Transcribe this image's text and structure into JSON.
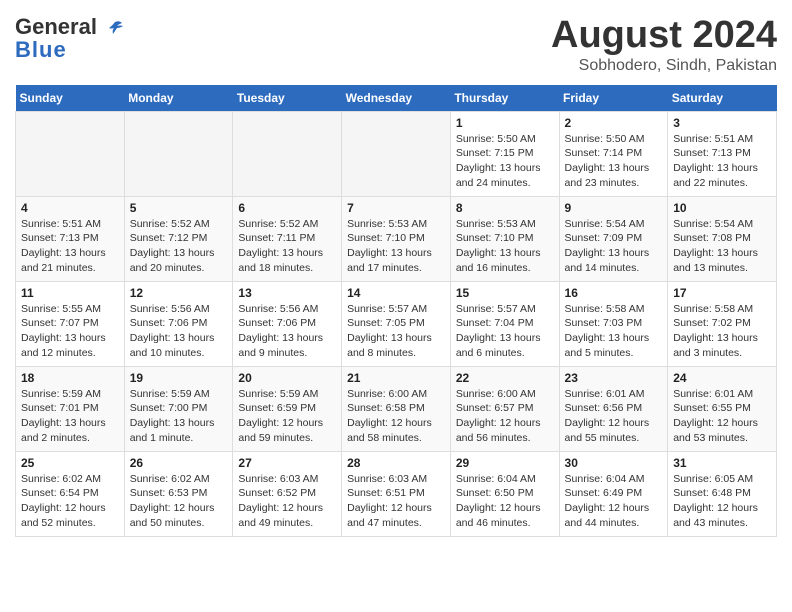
{
  "header": {
    "logo_line1": "General",
    "logo_line2": "Blue",
    "main_title": "August 2024",
    "subtitle": "Sobhodero, Sindh, Pakistan"
  },
  "calendar": {
    "days_of_week": [
      "Sunday",
      "Monday",
      "Tuesday",
      "Wednesday",
      "Thursday",
      "Friday",
      "Saturday"
    ],
    "weeks": [
      [
        {
          "day": "",
          "empty": true
        },
        {
          "day": "",
          "empty": true
        },
        {
          "day": "",
          "empty": true
        },
        {
          "day": "",
          "empty": true
        },
        {
          "day": "1",
          "sunrise": "5:50 AM",
          "sunset": "7:15 PM",
          "daylight": "13 hours and 24 minutes."
        },
        {
          "day": "2",
          "sunrise": "5:50 AM",
          "sunset": "7:14 PM",
          "daylight": "13 hours and 23 minutes."
        },
        {
          "day": "3",
          "sunrise": "5:51 AM",
          "sunset": "7:13 PM",
          "daylight": "13 hours and 22 minutes."
        }
      ],
      [
        {
          "day": "4",
          "sunrise": "5:51 AM",
          "sunset": "7:13 PM",
          "daylight": "13 hours and 21 minutes."
        },
        {
          "day": "5",
          "sunrise": "5:52 AM",
          "sunset": "7:12 PM",
          "daylight": "13 hours and 20 minutes."
        },
        {
          "day": "6",
          "sunrise": "5:52 AM",
          "sunset": "7:11 PM",
          "daylight": "13 hours and 18 minutes."
        },
        {
          "day": "7",
          "sunrise": "5:53 AM",
          "sunset": "7:10 PM",
          "daylight": "13 hours and 17 minutes."
        },
        {
          "day": "8",
          "sunrise": "5:53 AM",
          "sunset": "7:10 PM",
          "daylight": "13 hours and 16 minutes."
        },
        {
          "day": "9",
          "sunrise": "5:54 AM",
          "sunset": "7:09 PM",
          "daylight": "13 hours and 14 minutes."
        },
        {
          "day": "10",
          "sunrise": "5:54 AM",
          "sunset": "7:08 PM",
          "daylight": "13 hours and 13 minutes."
        }
      ],
      [
        {
          "day": "11",
          "sunrise": "5:55 AM",
          "sunset": "7:07 PM",
          "daylight": "13 hours and 12 minutes."
        },
        {
          "day": "12",
          "sunrise": "5:56 AM",
          "sunset": "7:06 PM",
          "daylight": "13 hours and 10 minutes."
        },
        {
          "day": "13",
          "sunrise": "5:56 AM",
          "sunset": "7:06 PM",
          "daylight": "13 hours and 9 minutes."
        },
        {
          "day": "14",
          "sunrise": "5:57 AM",
          "sunset": "7:05 PM",
          "daylight": "13 hours and 8 minutes."
        },
        {
          "day": "15",
          "sunrise": "5:57 AM",
          "sunset": "7:04 PM",
          "daylight": "13 hours and 6 minutes."
        },
        {
          "day": "16",
          "sunrise": "5:58 AM",
          "sunset": "7:03 PM",
          "daylight": "13 hours and 5 minutes."
        },
        {
          "day": "17",
          "sunrise": "5:58 AM",
          "sunset": "7:02 PM",
          "daylight": "13 hours and 3 minutes."
        }
      ],
      [
        {
          "day": "18",
          "sunrise": "5:59 AM",
          "sunset": "7:01 PM",
          "daylight": "13 hours and 2 minutes."
        },
        {
          "day": "19",
          "sunrise": "5:59 AM",
          "sunset": "7:00 PM",
          "daylight": "13 hours and 1 minute."
        },
        {
          "day": "20",
          "sunrise": "5:59 AM",
          "sunset": "6:59 PM",
          "daylight": "12 hours and 59 minutes."
        },
        {
          "day": "21",
          "sunrise": "6:00 AM",
          "sunset": "6:58 PM",
          "daylight": "12 hours and 58 minutes."
        },
        {
          "day": "22",
          "sunrise": "6:00 AM",
          "sunset": "6:57 PM",
          "daylight": "12 hours and 56 minutes."
        },
        {
          "day": "23",
          "sunrise": "6:01 AM",
          "sunset": "6:56 PM",
          "daylight": "12 hours and 55 minutes."
        },
        {
          "day": "24",
          "sunrise": "6:01 AM",
          "sunset": "6:55 PM",
          "daylight": "12 hours and 53 minutes."
        }
      ],
      [
        {
          "day": "25",
          "sunrise": "6:02 AM",
          "sunset": "6:54 PM",
          "daylight": "12 hours and 52 minutes."
        },
        {
          "day": "26",
          "sunrise": "6:02 AM",
          "sunset": "6:53 PM",
          "daylight": "12 hours and 50 minutes."
        },
        {
          "day": "27",
          "sunrise": "6:03 AM",
          "sunset": "6:52 PM",
          "daylight": "12 hours and 49 minutes."
        },
        {
          "day": "28",
          "sunrise": "6:03 AM",
          "sunset": "6:51 PM",
          "daylight": "12 hours and 47 minutes."
        },
        {
          "day": "29",
          "sunrise": "6:04 AM",
          "sunset": "6:50 PM",
          "daylight": "12 hours and 46 minutes."
        },
        {
          "day": "30",
          "sunrise": "6:04 AM",
          "sunset": "6:49 PM",
          "daylight": "12 hours and 44 minutes."
        },
        {
          "day": "31",
          "sunrise": "6:05 AM",
          "sunset": "6:48 PM",
          "daylight": "12 hours and 43 minutes."
        }
      ]
    ]
  }
}
